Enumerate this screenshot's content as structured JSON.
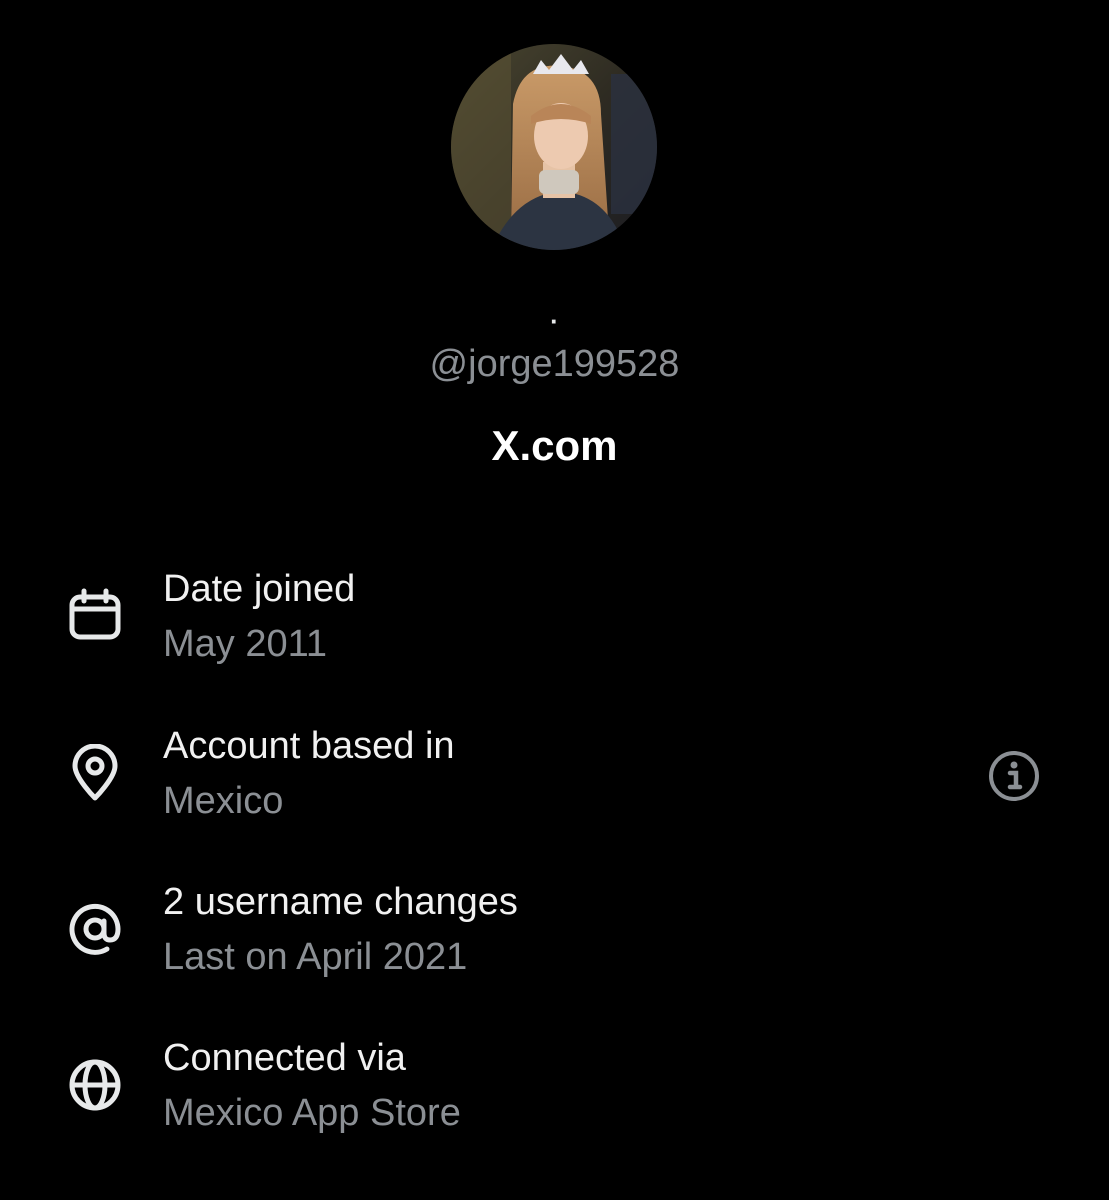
{
  "profile": {
    "display_name": "·",
    "handle": "@jorge199528",
    "site": "X.com"
  },
  "rows": [
    {
      "icon": "calendar-icon",
      "title": "Date joined",
      "value": "May 2011"
    },
    {
      "icon": "location-pin-icon",
      "title": "Account based in",
      "value": "Mexico"
    },
    {
      "icon": "at-sign-icon",
      "title": "2 username changes",
      "value": "Last on April 2021"
    },
    {
      "icon": "globe-icon",
      "title": "Connected via",
      "value": "Mexico App Store"
    }
  ],
  "colors": {
    "background": "#000000",
    "primary_text": "#e7e9ea",
    "secondary_text": "#8b8f94",
    "icon": "#e7e9ea",
    "info_icon": "#8b8f94"
  }
}
